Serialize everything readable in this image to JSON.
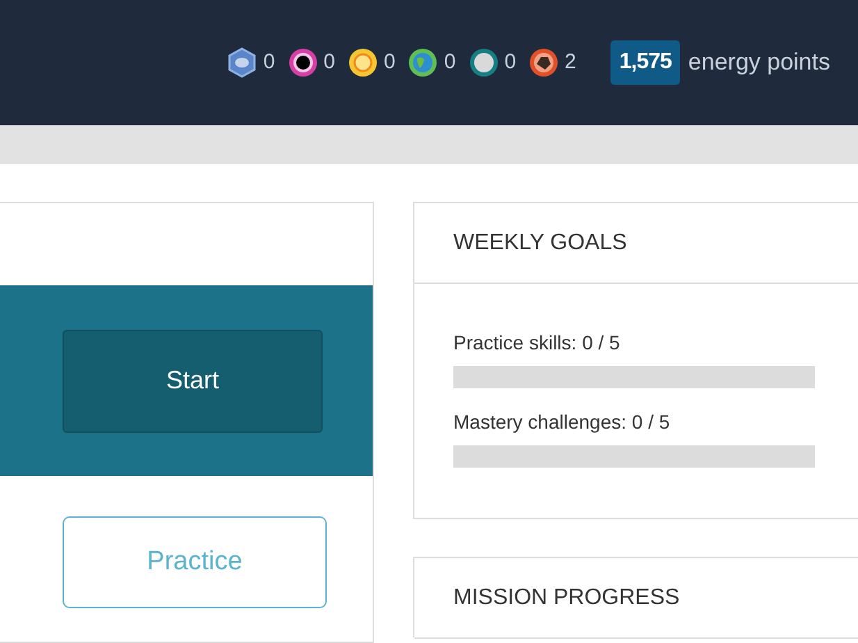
{
  "header": {
    "badges": [
      {
        "kind": "meteorite",
        "count": "0"
      },
      {
        "kind": "moon",
        "count": "0"
      },
      {
        "kind": "earth",
        "count": "0"
      },
      {
        "kind": "sun",
        "count": "0"
      },
      {
        "kind": "blackhole",
        "count": "0"
      },
      {
        "kind": "challenge",
        "count": "2"
      }
    ],
    "energy": {
      "points": "1,575",
      "label": "energy points"
    }
  },
  "task_card": {
    "start_button": "Start",
    "practice_button": "Practice"
  },
  "weekly_goals": {
    "title": "WEEKLY GOALS",
    "goals": [
      {
        "label": "Practice skills: 0 / 5",
        "level": 0
      },
      {
        "label": "Mastery challenges: 0 / 5",
        "level": 0
      }
    ]
  },
  "mission_progress": {
    "title": "MISSION PROGRESS"
  }
}
